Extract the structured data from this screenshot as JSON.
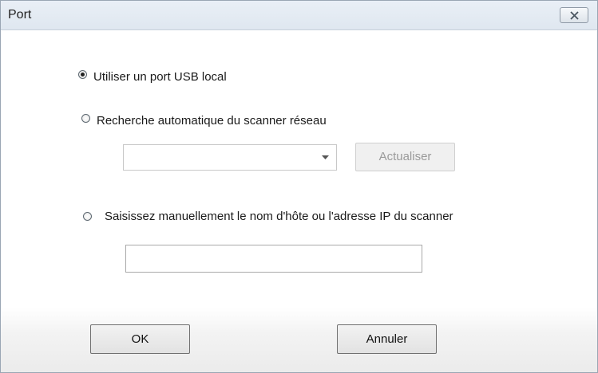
{
  "window": {
    "title": "Port",
    "close_icon": "close-icon"
  },
  "options": {
    "usb_label": "Utiliser un port USB local",
    "usb_selected": true,
    "auto_label": "Recherche automatique du scanner réseau",
    "auto_selected": false,
    "manual_label": "Saisissez manuellement le nom d'hôte ou l'adresse IP du scanner",
    "manual_selected": false
  },
  "scanner_select": {
    "value": "",
    "arrow_icon": "chevron-down-icon"
  },
  "refresh_button": {
    "label": "Actualiser",
    "enabled": false
  },
  "host_input": {
    "value": ""
  },
  "buttons": {
    "ok": "OK",
    "cancel": "Annuler"
  }
}
